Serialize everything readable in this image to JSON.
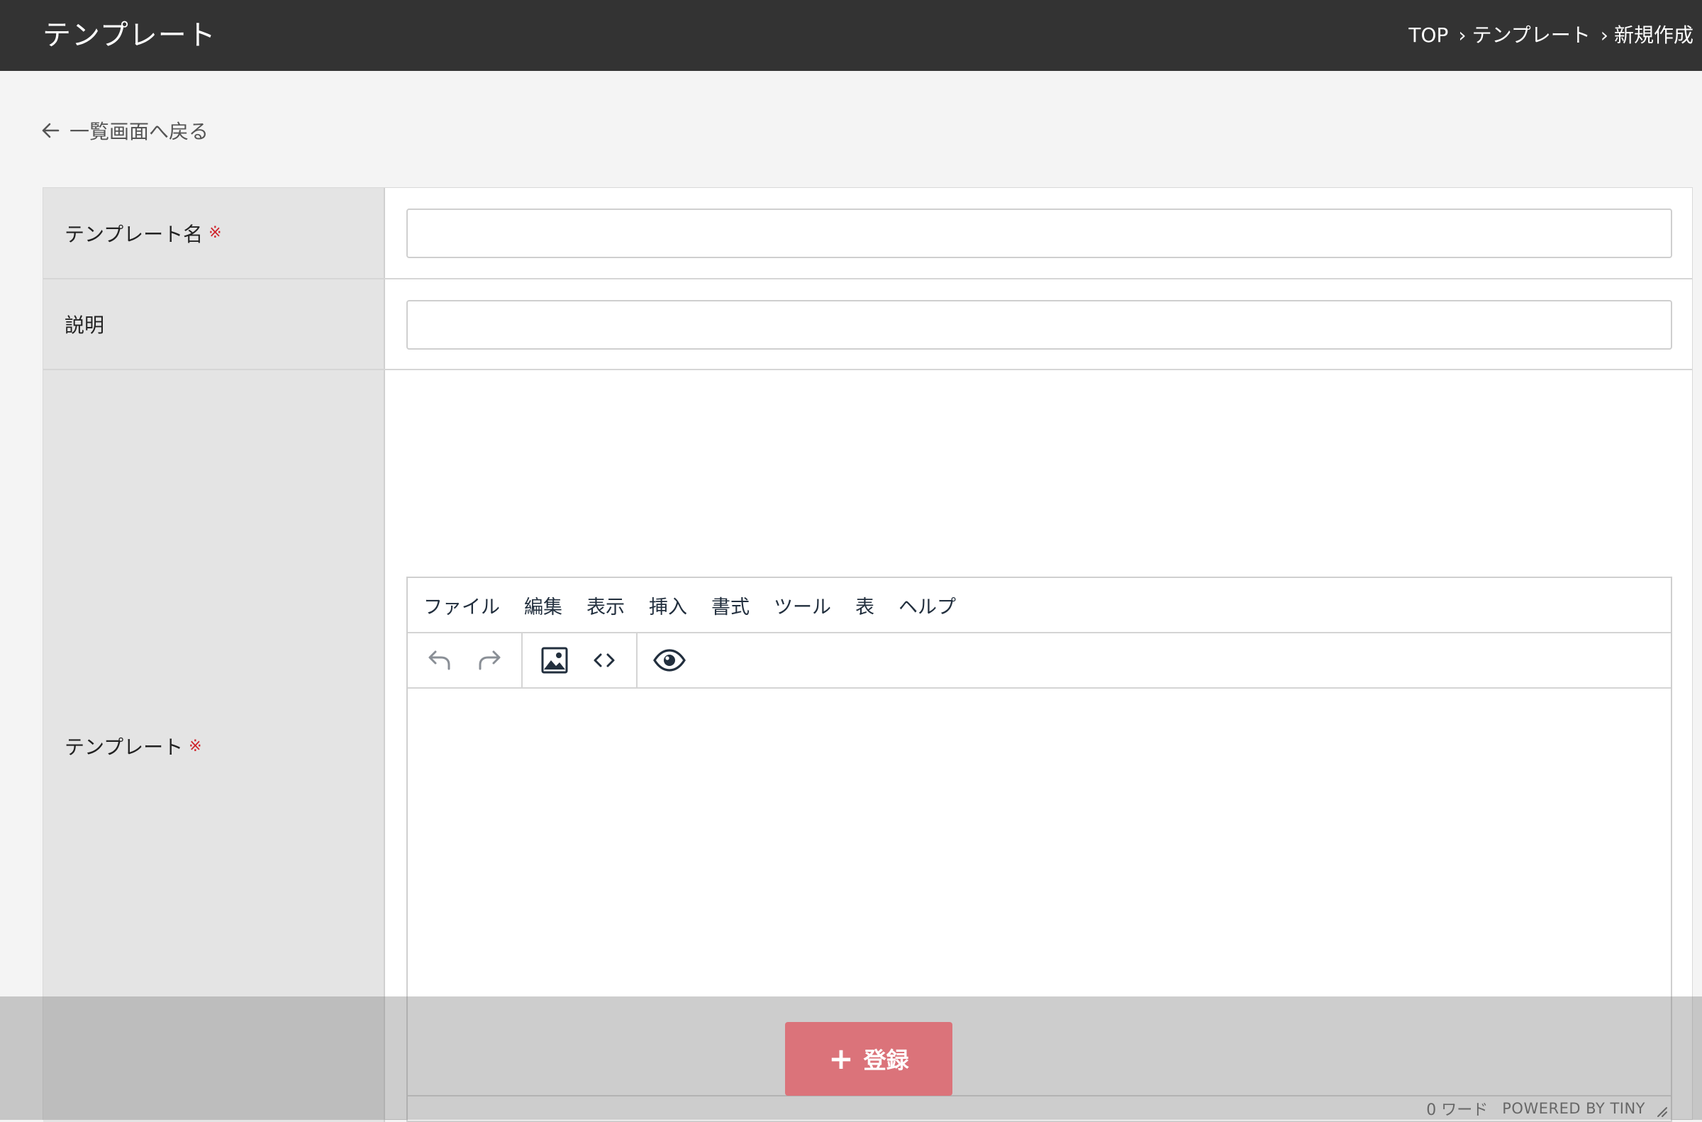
{
  "header": {
    "title": "テンプレート",
    "breadcrumb": [
      "TOP",
      "テンプレート",
      "新規作成"
    ],
    "separator": "›"
  },
  "back_link": {
    "label": "一覧画面へ戻る"
  },
  "form": {
    "required_mark": "※",
    "name": {
      "label": "テンプレート名",
      "value": "",
      "placeholder": ""
    },
    "description": {
      "label": "説明",
      "value": "",
      "placeholder": ""
    },
    "template": {
      "label": "テンプレート"
    }
  },
  "editor": {
    "menu": [
      "ファイル",
      "編集",
      "表示",
      "挿入",
      "書式",
      "ツール",
      "表",
      "ヘルプ"
    ],
    "toolbar_icons": [
      "undo-icon",
      "redo-icon",
      "image-icon",
      "code-icon",
      "preview-icon"
    ],
    "word_count": "0 ワード",
    "powered_by": "POWERED BY TINY"
  },
  "submit": {
    "label": "登録",
    "icon": "plus-icon",
    "color": "#db737a"
  },
  "colors": {
    "header_bg": "#333333",
    "required": "#d0232b",
    "label_bg": "#e4e4e4"
  }
}
